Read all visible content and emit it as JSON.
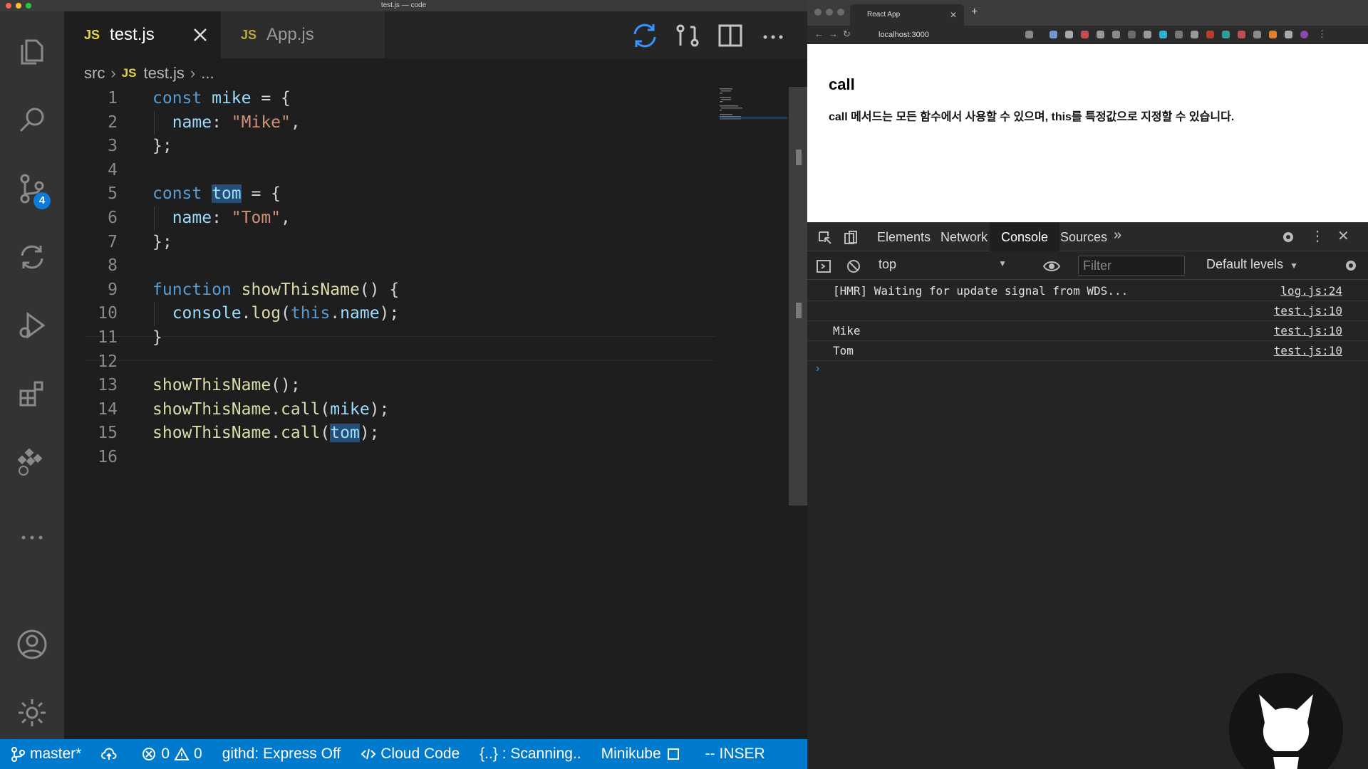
{
  "vscode": {
    "window_title": "test.js — code",
    "tabs": [
      {
        "label": "test.js",
        "lang": "JS",
        "active": true
      },
      {
        "label": "App.js",
        "lang": "JS",
        "active": false
      }
    ],
    "breadcrumb": {
      "folder": "src",
      "lang": "JS",
      "file": "test.js",
      "more": "..."
    },
    "source_control_badge": "4",
    "lines": [
      {
        "n": "1",
        "tokens": [
          [
            "kw",
            "const "
          ],
          [
            "var",
            "mike"
          ],
          [
            "pl",
            " = {"
          ]
        ]
      },
      {
        "n": "2",
        "tokens": [
          [
            "pl",
            "  "
          ],
          [
            "var",
            "name"
          ],
          [
            "pl",
            ": "
          ],
          [
            "str",
            "\"Mike\""
          ],
          [
            "pl",
            ","
          ]
        ]
      },
      {
        "n": "3",
        "tokens": [
          [
            "pl",
            "};"
          ]
        ]
      },
      {
        "n": "4",
        "tokens": []
      },
      {
        "n": "5",
        "tokens": [
          [
            "kw",
            "const "
          ],
          [
            "hlvar",
            "tom"
          ],
          [
            "pl",
            " = {"
          ]
        ]
      },
      {
        "n": "6",
        "tokens": [
          [
            "pl",
            "  "
          ],
          [
            "var",
            "name"
          ],
          [
            "pl",
            ": "
          ],
          [
            "str",
            "\"Tom\""
          ],
          [
            "pl",
            ","
          ]
        ]
      },
      {
        "n": "7",
        "tokens": [
          [
            "pl",
            "};"
          ]
        ]
      },
      {
        "n": "8",
        "tokens": []
      },
      {
        "n": "9",
        "tokens": [
          [
            "kw",
            "function "
          ],
          [
            "fn",
            "showThisName"
          ],
          [
            "pl",
            "() {"
          ]
        ]
      },
      {
        "n": "10",
        "tokens": [
          [
            "pl",
            "  "
          ],
          [
            "var",
            "console"
          ],
          [
            "pl",
            "."
          ],
          [
            "fn",
            "log"
          ],
          [
            "pl",
            "("
          ],
          [
            "kw",
            "this"
          ],
          [
            "pl",
            "."
          ],
          [
            "var",
            "name"
          ],
          [
            "pl",
            ");"
          ]
        ]
      },
      {
        "n": "11",
        "tokens": [
          [
            "pl",
            "}"
          ]
        ]
      },
      {
        "n": "12",
        "tokens": []
      },
      {
        "n": "13",
        "tokens": [
          [
            "fn",
            "showThisName"
          ],
          [
            "pl",
            "();"
          ]
        ]
      },
      {
        "n": "14",
        "tokens": [
          [
            "fn",
            "showThisName"
          ],
          [
            "pl",
            "."
          ],
          [
            "fn",
            "call"
          ],
          [
            "pl",
            "("
          ],
          [
            "var",
            "mike"
          ],
          [
            "pl",
            ");"
          ]
        ]
      },
      {
        "n": "15",
        "tokens": [
          [
            "fn",
            "showThisName"
          ],
          [
            "pl",
            "."
          ],
          [
            "fn",
            "call"
          ],
          [
            "pl",
            "("
          ],
          [
            "hlvar",
            "tom"
          ],
          [
            "pl",
            ");"
          ]
        ]
      },
      {
        "n": "16",
        "tokens": []
      }
    ],
    "status": {
      "branch": "master*",
      "errors": "0",
      "warnings": "0",
      "githd": "githd: Express Off",
      "cloud": "Cloud Code",
      "scanning": "{..} : Scanning..",
      "minikube": "Minikube",
      "mode": "-- INSER"
    }
  },
  "browser": {
    "tab_title": "React App",
    "url": "localhost:3000",
    "page_heading": "call",
    "page_text": "call 메서드는 모든 함수에서 사용할 수 있으며, this를 특정값으로 지정할 수 있습니다.",
    "devtools": {
      "tabs": [
        "Elements",
        "Network",
        "Console",
        "Sources"
      ],
      "active_tab": "Console",
      "context": "top",
      "filter_placeholder": "Filter",
      "levels": "Default levels",
      "messages": [
        {
          "text": "[HMR] Waiting for update signal from WDS...",
          "source": "log.js:24"
        },
        {
          "text": "",
          "source": "test.js:10"
        },
        {
          "text": "Mike",
          "source": "test.js:10"
        },
        {
          "text": "Tom",
          "source": "test.js:10"
        }
      ]
    }
  },
  "colors": {
    "statusbar": "#007acc",
    "activitybar": "#333333",
    "editor_bg": "#1e1e1e",
    "keyword": "#569cd6",
    "string": "#ce9178",
    "function": "#dcdcaa",
    "variable": "#9cdcfe"
  },
  "icons": [
    "files-icon",
    "search-icon",
    "source-control-icon",
    "sync-icon",
    "run-debug-icon",
    "extensions-icon",
    "kubernetes-icon",
    "more-icon",
    "account-icon",
    "settings-gear-icon"
  ]
}
